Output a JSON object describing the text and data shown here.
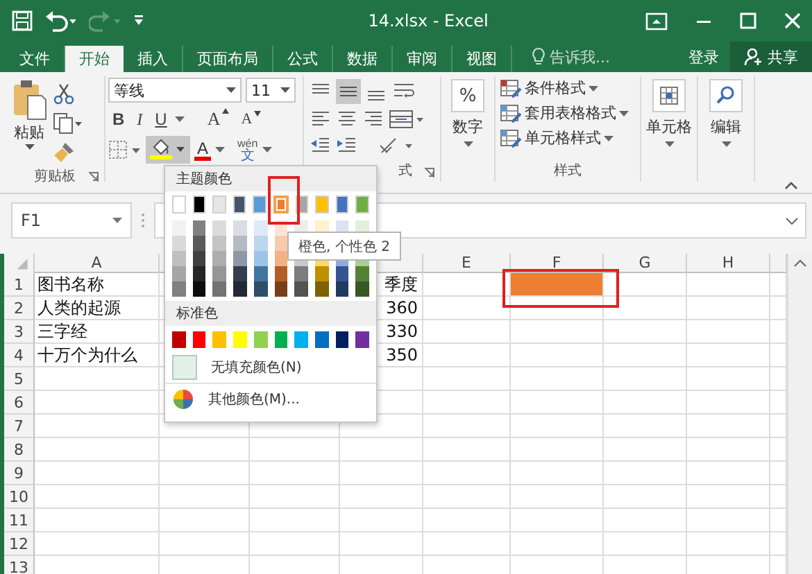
{
  "title_bar": {
    "title": "14.xlsx - Excel"
  },
  "tabs": [
    {
      "label": "文件",
      "selected": false
    },
    {
      "label": "开始",
      "selected": true
    },
    {
      "label": "插入",
      "selected": false
    },
    {
      "label": "页面布局",
      "selected": false
    },
    {
      "label": "公式",
      "selected": false
    },
    {
      "label": "数据",
      "selected": false
    },
    {
      "label": "审阅",
      "selected": false
    },
    {
      "label": "视图",
      "selected": false
    }
  ],
  "tell_me": {
    "placeholder": "告诉我..."
  },
  "sign_in": "登录",
  "share": "共享",
  "ribbon": {
    "paste": "粘贴",
    "clipboard_label": "剪贴板",
    "font_name": "等线",
    "font_size": "11",
    "bold": "B",
    "italic": "I",
    "underline": "U",
    "grow_font": "A",
    "shrink_font": "A",
    "font_color": "A",
    "phonetic_top": "wén",
    "phonetic_bottom": "文",
    "alignment_label": "式",
    "percent": "%",
    "number": "数字",
    "styles": [
      "条件格式",
      "套用表格格式",
      "单元格样式"
    ],
    "styles_label": "样式",
    "cells": "单元格",
    "editing": "编辑"
  },
  "formula_bar": {
    "name_box": "F1"
  },
  "sheet": {
    "columns": [
      {
        "label": "A"
      },
      {},
      {},
      {},
      {
        "label": "E"
      },
      {
        "label": "F"
      },
      {
        "label": "G"
      },
      {
        "label": "H"
      }
    ],
    "row_numbers": [
      "1",
      "2",
      "3",
      "4",
      "5",
      "6",
      "7",
      "8",
      "9",
      "10",
      "11",
      "12",
      "13"
    ],
    "rows": [
      {
        "col_a": "图书名称",
        "col_d": "季度",
        "col_f": {
          "color": "#ed7d31"
        }
      },
      {
        "col_a": "人类的起源",
        "col_d": "360"
      },
      {
        "col_a": "三字经",
        "col_d": "330"
      },
      {
        "col_a": "十万个为什么",
        "col_d": "350"
      }
    ]
  },
  "color_menu": {
    "theme_title": "主题颜色",
    "theme_colors": [
      {
        "color": "#ffffff",
        "selected": false
      },
      {
        "color": "#000000",
        "selected": false
      },
      {
        "color": "#e7e6e6",
        "selected": false
      },
      {
        "color": "#44546a",
        "selected": false
      },
      {
        "color": "#5b9bd5",
        "selected": false
      },
      {
        "color": "#ed7d31",
        "selected": true
      },
      {
        "color": "#a5a5a5",
        "selected": false
      },
      {
        "color": "#ffc000",
        "selected": false
      },
      {
        "color": "#4472c4",
        "selected": false
      },
      {
        "color": "#70ad47",
        "selected": false
      }
    ],
    "standard_title": "标准色",
    "standard_colors": [
      {
        "color": "#c00000"
      },
      {
        "color": "#ff0000"
      },
      {
        "color": "#ffc000"
      },
      {
        "color": "#ffff00"
      },
      {
        "color": "#92d050"
      },
      {
        "color": "#00b050"
      },
      {
        "color": "#00b0f0"
      },
      {
        "color": "#0070c0"
      },
      {
        "color": "#002060"
      },
      {
        "color": "#7030a0"
      }
    ],
    "no_fill": "无填充颜色(N)",
    "more_colors": "其他颜色(M)..."
  },
  "tooltip": "橙色, 个性色 2",
  "highlights": {
    "swatch": true,
    "cell": true
  }
}
